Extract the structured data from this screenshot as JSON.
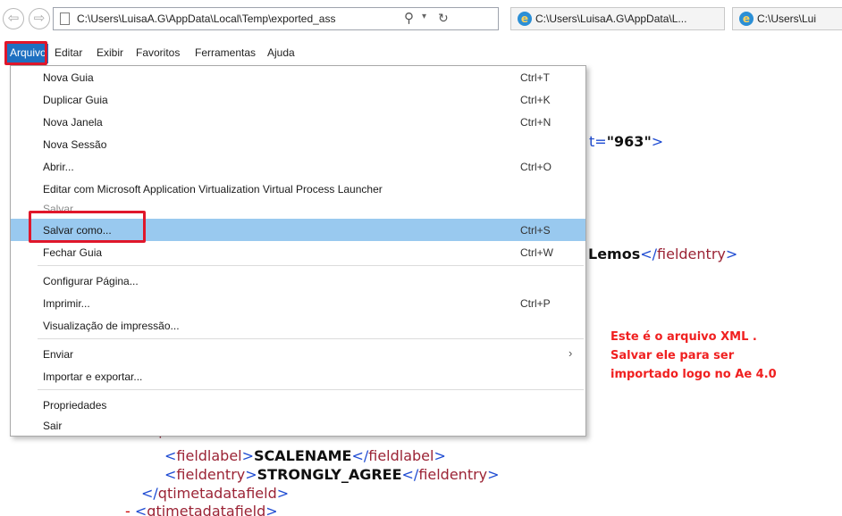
{
  "window": {
    "address": "C:\\Users\\LuisaA.G\\AppData\\Local\\Temp\\exported_ass",
    "tabs": [
      {
        "label": "C:\\Users\\LuisaA.G\\AppData\\L..."
      },
      {
        "label": "C:\\Users\\Lui"
      }
    ]
  },
  "menubar": {
    "items": [
      "Arquivo",
      "Editar",
      "Exibir",
      "Favoritos",
      "Ferramentas",
      "Ajuda"
    ]
  },
  "file_menu": {
    "items": [
      {
        "label": "Nova Guia",
        "shortcut": "Ctrl+T"
      },
      {
        "label": "Duplicar Guia",
        "shortcut": "Ctrl+K"
      },
      {
        "label": "Nova Janela",
        "shortcut": "Ctrl+N"
      },
      {
        "label": "Nova Sessão",
        "shortcut": ""
      },
      {
        "label": "Abrir...",
        "shortcut": "Ctrl+O"
      },
      {
        "label": "Editar com Microsoft Application Virtualization Virtual Process Launcher",
        "shortcut": ""
      },
      {
        "label": "Salvar",
        "shortcut": ""
      },
      {
        "label": "Salvar como...",
        "shortcut": "Ctrl+S"
      },
      {
        "label": "Fechar Guia",
        "shortcut": "Ctrl+W"
      },
      {
        "label": "Configurar Página...",
        "shortcut": ""
      },
      {
        "label": "Imprimir...",
        "shortcut": "Ctrl+P"
      },
      {
        "label": "Visualização de impressão...",
        "shortcut": ""
      },
      {
        "label": "Enviar",
        "shortcut": "",
        "submenu_arrow": "›"
      },
      {
        "label": "Importar e exportar...",
        "shortcut": ""
      },
      {
        "label": "Propriedades",
        "shortcut": ""
      },
      {
        "label": "Sair",
        "shortcut": ""
      }
    ]
  },
  "xml": {
    "line1_value": "963",
    "line2_value": "Lemos",
    "line2_close": "fieldentry",
    "partial_tag": "qtimetadatafield",
    "label_open": "fieldlabel",
    "label_value": "SCALENAME",
    "label_close": "fieldlabel",
    "entry_open": "fieldentry",
    "entry_value": "STRONGLY_AGREE",
    "entry_close": "fieldentry",
    "close_tag": "qtimetadatafield",
    "next_tag": "qtimetadatafield",
    "dash": "-"
  },
  "annotation": {
    "line1": "Este é o arquivo XML .",
    "line2": "Salvar ele para ser",
    "line3": "importado logo no Ae 4.0"
  },
  "colors": {
    "highlight": "#99c9ef",
    "menu_active": "#1e70c1",
    "callout_red": "#e0172b",
    "xml_tag": "#9b2335",
    "xml_bracket": "#1e4bd2",
    "annotation_text": "#f02020"
  },
  "icons": {
    "back": "arrow-left-icon",
    "forward": "arrow-right-icon",
    "page": "page-icon",
    "search": "search-icon",
    "refresh": "refresh-icon",
    "tab": "ie-logo-icon"
  }
}
